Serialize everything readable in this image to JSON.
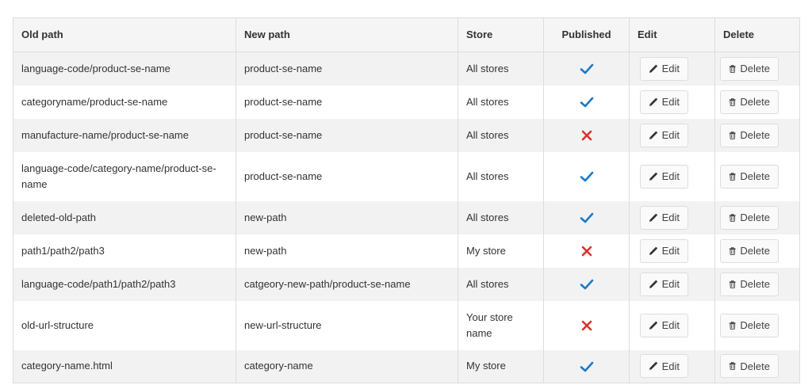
{
  "table": {
    "headers": {
      "old_path": "Old path",
      "new_path": "New path",
      "store": "Store",
      "published": "Published",
      "edit": "Edit",
      "delete": "Delete"
    },
    "edit_label": "Edit",
    "delete_label": "Delete",
    "colors": {
      "check": "#1a7ac9",
      "cross": "#d9322c"
    },
    "rows": [
      {
        "old_path": "language-code/product-se-name",
        "new_path": "product-se-name",
        "store": "All stores",
        "published": true
      },
      {
        "old_path": "categoryname/product-se-name",
        "new_path": "product-se-name",
        "store": "All stores",
        "published": true
      },
      {
        "old_path": "manufacture-name/product-se-name",
        "new_path": "product-se-name",
        "store": "All stores",
        "published": false
      },
      {
        "old_path": "language-code/category-name/product-se-name",
        "new_path": "product-se-name",
        "store": "All stores",
        "published": true
      },
      {
        "old_path": "deleted-old-path",
        "new_path": "new-path",
        "store": "All stores",
        "published": true
      },
      {
        "old_path": "path1/path2/path3",
        "new_path": "new-path",
        "store": "My store",
        "published": false
      },
      {
        "old_path": "language-code/path1/path2/path3",
        "new_path": "catgeory-new-path/product-se-name",
        "store": "All stores",
        "published": true
      },
      {
        "old_path": "old-url-structure",
        "new_path": "new-url-structure",
        "store": "Your store name",
        "published": false
      },
      {
        "old_path": "category-name.html",
        "new_path": "category-name",
        "store": "My store",
        "published": true
      }
    ]
  }
}
